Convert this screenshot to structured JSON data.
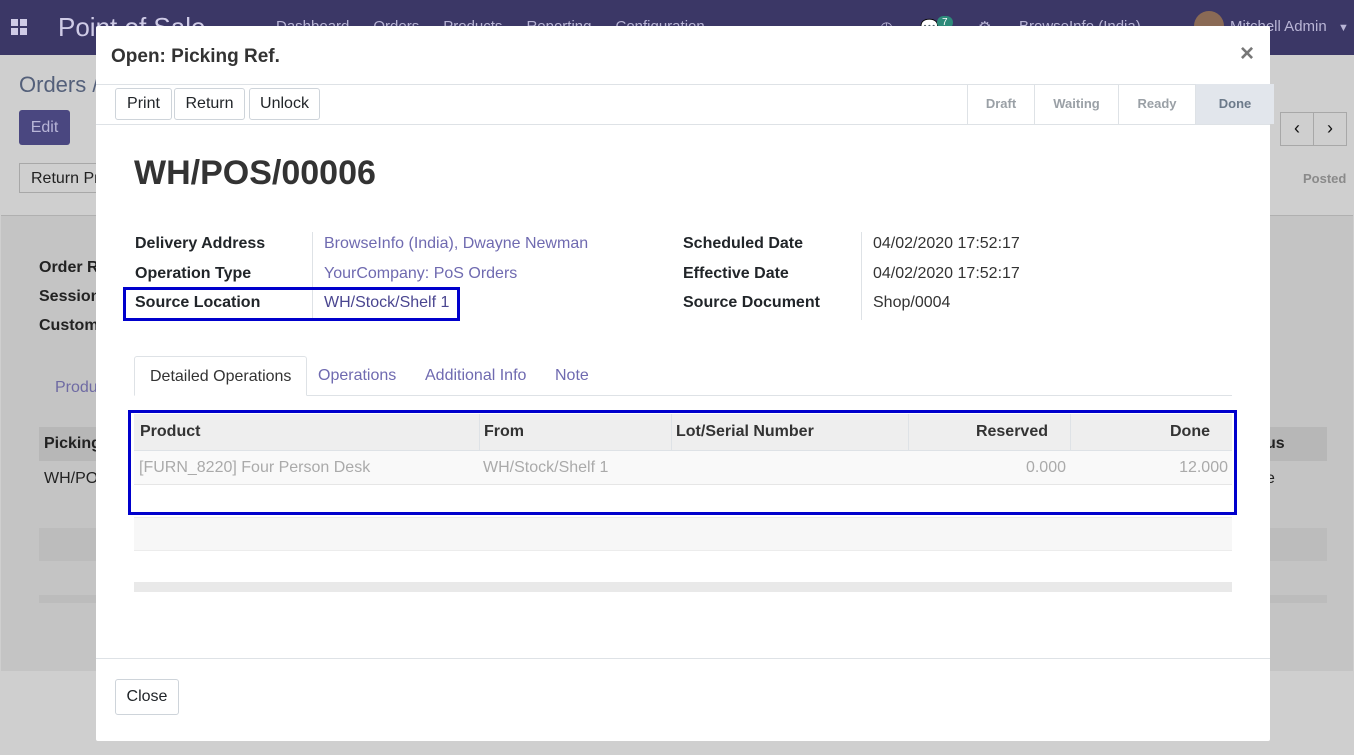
{
  "background": {
    "app_name": "Point of Sale",
    "menu": [
      "Dashboard",
      "Orders",
      "Products",
      "Reporting",
      "Configuration"
    ],
    "messages_count": "7",
    "company": "BrowseInfo (India)",
    "user": "Mitchell Admin",
    "breadcrumb": "Orders /",
    "edit_label": "Edit",
    "return_label": "Return Pr",
    "posted_label": "Posted",
    "labels": [
      "Order R",
      "Session",
      "Custom"
    ],
    "tab_label": "Produ",
    "table_header": "Picking",
    "status_header": "us",
    "row_value": "WH/PO",
    "row_status": "e"
  },
  "modal": {
    "title": "Open: Picking Ref.",
    "close_symbol": "×",
    "buttons": {
      "print": "Print",
      "return": "Return",
      "unlock": "Unlock"
    },
    "stages": [
      "Draft",
      "Waiting",
      "Ready",
      "Done"
    ],
    "active_stage": "Done",
    "record_name": "WH/POS/00006",
    "left_fields": [
      {
        "label": "Delivery Address",
        "value": "BrowseInfo (India), Dwayne Newman"
      },
      {
        "label": "Operation Type",
        "value": "YourCompany: PoS Orders"
      },
      {
        "label": "Source Location",
        "value": "WH/Stock/Shelf 1"
      }
    ],
    "right_fields": [
      {
        "label": "Scheduled Date",
        "value": "04/02/2020 17:52:17"
      },
      {
        "label": "Effective Date",
        "value": "04/02/2020 17:52:17"
      },
      {
        "label": "Source Document",
        "value": "Shop/0004"
      }
    ],
    "tabs": [
      "Detailed Operations",
      "Operations",
      "Additional Info",
      "Note"
    ],
    "active_tab": "Detailed Operations",
    "table": {
      "columns": [
        "Product",
        "From",
        "Lot/Serial Number",
        "Reserved",
        "Done"
      ],
      "rows": [
        {
          "product": "[FURN_8220] Four Person Desk",
          "from": "WH/Stock/Shelf 1",
          "lot": "",
          "reserved": "0.000",
          "done": "12.000"
        }
      ]
    },
    "footer": {
      "close_label": "Close"
    }
  },
  "highlight_color": "#0000cc"
}
